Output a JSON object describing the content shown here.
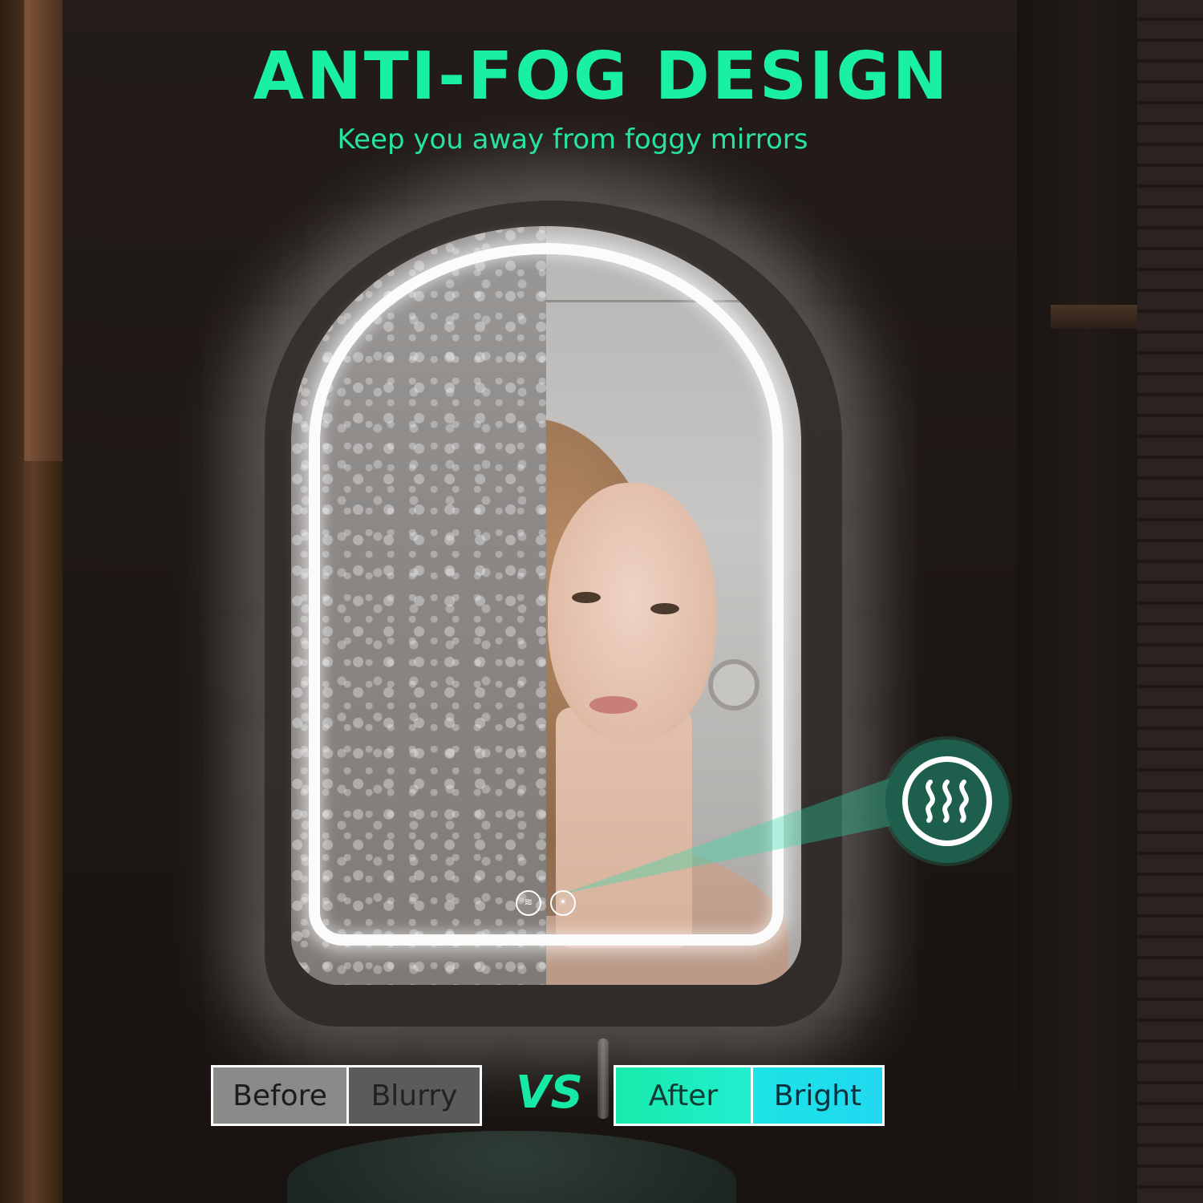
{
  "header": {
    "title": "ANTI-FOG DESIGN",
    "subtitle": "Keep you away from foggy mirrors"
  },
  "mirror": {
    "controls": [
      {
        "icon": "defog-icon",
        "glyph": "≋"
      },
      {
        "icon": "light-bulb-icon",
        "glyph": "☀"
      }
    ]
  },
  "callout": {
    "icon": "defog-icon"
  },
  "comparison": {
    "before": {
      "label": "Before",
      "state": "Blurry"
    },
    "vs": "VS",
    "after": {
      "label": "After",
      "state": "Bright"
    }
  },
  "colors": {
    "accent_green": "#19f0a1",
    "callout_bg": "#1d5f4c",
    "after_cyan": "#20d8f0",
    "before_gray": "#8a8a8a"
  }
}
